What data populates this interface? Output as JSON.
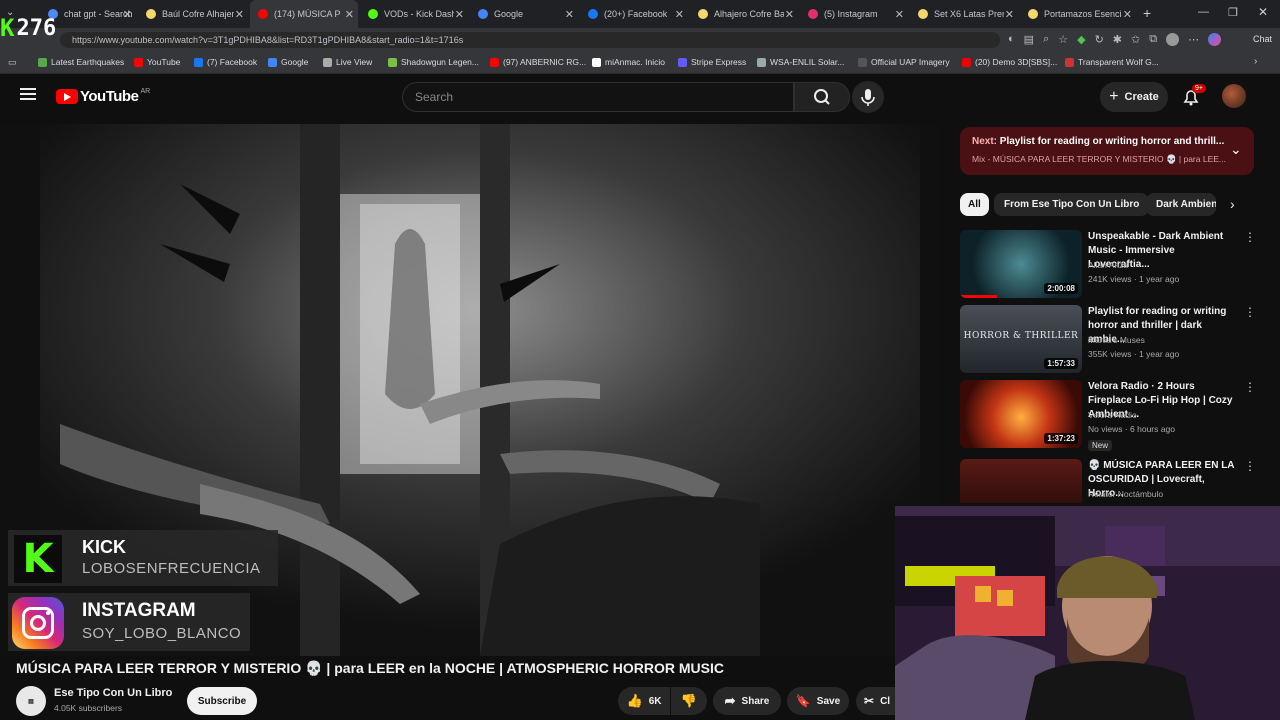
{
  "browser": {
    "tabs": [
      {
        "title": "chat gpt - Search",
        "color": "#4c8bf5"
      },
      {
        "title": "Baúl Cofre Alhajero",
        "color": "#f5d76e"
      },
      {
        "title": "(174) MÚSICA P",
        "color": "#ff0000"
      },
      {
        "title": "VODs - Kick Dashbo",
        "color": "#53fc18"
      },
      {
        "title": "Google",
        "color": "#4285f4"
      },
      {
        "title": "(20+) Facebook",
        "color": "#1877f2"
      },
      {
        "title": "Alhajero Cofre Baul",
        "color": "#f5d76e"
      },
      {
        "title": "(5) Instagram",
        "color": "#e1306c"
      },
      {
        "title": "Set X6 Latas Premiu",
        "color": "#f5d76e"
      },
      {
        "title": "Portamazos Esencial",
        "color": "#f5d76e"
      }
    ],
    "url": "https://www.youtube.com/watch?v=3T1gPDHIBA8&list=RD3T1gPDHIBA8&start_radio=1&t=1716s",
    "chat_label": "Chat",
    "stream_counter": "276",
    "bookmarks": [
      "Latest Earthquakes",
      "YouTube",
      "(7) Facebook",
      "Google",
      "Live View",
      "Shadowgun Legen...",
      "(97) ANBERNIC RG...",
      "miAnmac. Inicio",
      "Stripe Express",
      "WSA-ENLIL Solar...",
      "Official UAP Imagery",
      "(20) Demo 3D[SBS]...",
      "Transparent Wolf G..."
    ]
  },
  "youtube": {
    "logo": "YouTube",
    "country": "AR",
    "search_placeholder": "Search",
    "create_label": "Create",
    "notif_count": "9+",
    "video_title": "MÚSICA PARA LEER TERROR Y MISTERIO 💀 | para LEER en la NOCHE | ATMOSPHERIC HORROR MUSIC",
    "channel": "Ese Tipo Con Un Libro",
    "subscribers": "4.05K subscribers",
    "subscribe_label": "Subscribe",
    "likes": "6K",
    "share_label": "Share",
    "save_label": "Save",
    "clip_label": "Cl",
    "next": {
      "prefix": "Next:",
      "title": "Playlist for reading or writing horror and thrill...",
      "sub": "Mix - MÚSICA PARA LEER TERROR Y MISTERIO 💀 | para LEE..."
    },
    "chips": [
      "All",
      "From Ese Tipo Con Un Libro",
      "Dark Ambien"
    ],
    "recommendations": [
      {
        "title": "Unspeakable - Dark Ambient Music - Immersive Lovecraftia...",
        "channel": "Allan Ariza",
        "meta": "241K views · 1 year ago",
        "duration": "2:00:08",
        "badge": "",
        "thumb_text": ""
      },
      {
        "title": "Playlist for reading or writing horror and thriller | dark ambie...",
        "channel": "Martia's Muses",
        "meta": "355K views · 1 year ago",
        "duration": "1:57:33",
        "badge": "",
        "thumb_text": "HORROR & THRILLER"
      },
      {
        "title": "Velora Radio · 2 Hours Fireplace Lo-Fi Hip Hop | Cozy Ambient ...",
        "channel": "Velora Radio",
        "meta": "No views · 6 hours ago",
        "duration": "1:37:23",
        "badge": "New",
        "thumb_text": ""
      },
      {
        "title": "💀 MÚSICA PARA LEER EN LA OSCURIDAD | Lovecraft, Horro...",
        "channel": "Relator Noctámbulo",
        "meta": "",
        "duration": "",
        "badge": "",
        "thumb_text": ""
      }
    ]
  },
  "overlay": {
    "kick_title": "KICK",
    "kick_user": "LOBOSENFRECUENCIA",
    "ig_title": "INSTAGRAM",
    "ig_user": "SOY_LOBO_BLANCO"
  },
  "colors": {
    "youtube_red": "#ff0000",
    "kick_green": "#53fc18",
    "next_bg": "#4a1014"
  }
}
